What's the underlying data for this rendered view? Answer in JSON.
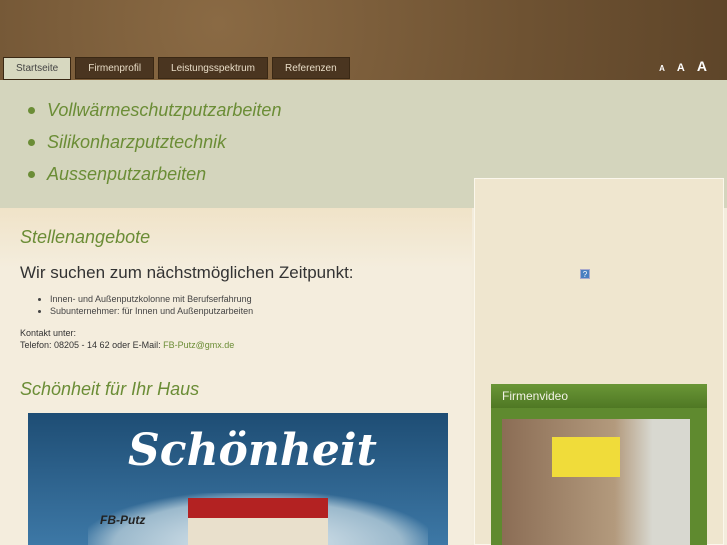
{
  "nav": {
    "tabs": [
      {
        "label": "Startseite",
        "active": true
      },
      {
        "label": "Firmenprofil"
      },
      {
        "label": "Leistungsspektrum"
      },
      {
        "label": "Referenzen"
      }
    ],
    "font_sizes": [
      "A",
      "A",
      "A"
    ]
  },
  "banner": {
    "items": [
      "Vollwärmeschutzputzarbeiten",
      "Silikonharzputztechnik",
      "Aussenputzarbeiten"
    ]
  },
  "main": {
    "jobs_title": "Stellenangebote",
    "jobs_heading": "Wir suchen zum nächstmöglichen Zeitpunkt:",
    "jobs": [
      "Innen- und Außenputzkolonne mit Berufserfahrung",
      "Subunternehmer: für Innen und Außenputzarbeiten"
    ],
    "contact_label": "Kontakt unter:",
    "contact_phone": "Telefon: 08205 - 14 62 oder E-Mail: ",
    "contact_email": "FB-Putz@gmx.de",
    "beauty_title": "Schönheit für Ihr Haus",
    "hero_script": "Schönheit",
    "hero_logo": "FB-Putz"
  },
  "sidebar": {
    "plugin_icon": "?",
    "video_title": "Firmenvideo"
  },
  "colors": {
    "accent": "#6b8d36",
    "header": "#6e5232"
  }
}
